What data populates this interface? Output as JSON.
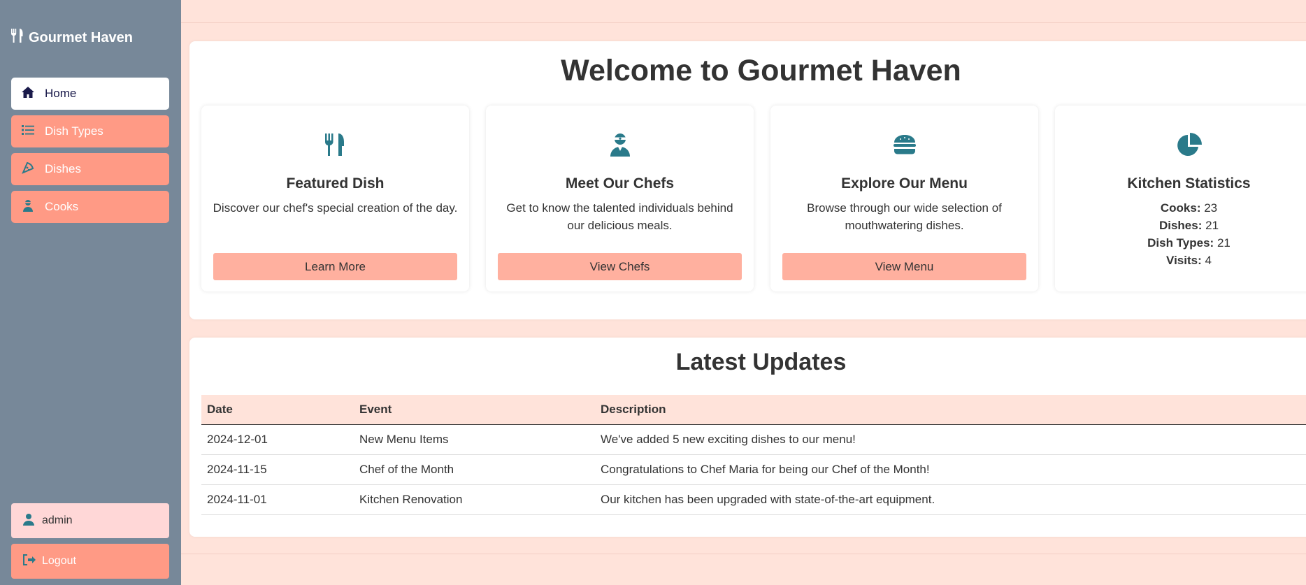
{
  "sidebar": {
    "brand": "Gourmet Haven",
    "items": [
      {
        "label": "Home",
        "icon": "home-icon"
      },
      {
        "label": "Dish Types",
        "icon": "list-icon"
      },
      {
        "label": "Dishes",
        "icon": "pizza-icon"
      },
      {
        "label": "Cooks",
        "icon": "chef-icon"
      }
    ],
    "user": "admin",
    "logout": "Logout"
  },
  "colors": {
    "sidebar_bg": "#778899",
    "accent": "#ff9a85",
    "button": "#ffb09f",
    "page_bg": "#ffe3da",
    "icon": "#2a7a8a"
  },
  "welcome": {
    "title": "Welcome to Gourmet Haven",
    "cards": [
      {
        "title": "Featured Dish",
        "text": "Discover our chef's special creation of the day.",
        "button": "Learn More",
        "icon": "utensils-icon"
      },
      {
        "title": "Meet Our Chefs",
        "text": "Get to know the talented individuals behind our delicious meals.",
        "button": "View Chefs",
        "icon": "chef-icon"
      },
      {
        "title": "Explore Our Menu",
        "text": "Browse through our wide selection of mouthwatering dishes.",
        "button": "View Menu",
        "icon": "burger-icon"
      },
      {
        "title": "Kitchen Statistics",
        "icon": "pie-chart-icon",
        "stats": [
          {
            "label": "Cooks:",
            "value": "23"
          },
          {
            "label": "Dishes:",
            "value": "21"
          },
          {
            "label": "Dish Types:",
            "value": "21"
          },
          {
            "label": "Visits:",
            "value": "4"
          }
        ]
      }
    ]
  },
  "updates": {
    "title": "Latest Updates",
    "columns": [
      "Date",
      "Event",
      "Description"
    ],
    "rows": [
      [
        "2024-12-01",
        "New Menu Items",
        "We've added 5 new exciting dishes to our menu!"
      ],
      [
        "2024-11-15",
        "Chef of the Month",
        "Congratulations to Chef Maria for being our Chef of the Month!"
      ],
      [
        "2024-11-01",
        "Kitchen Renovation",
        "Our kitchen has been upgraded with state-of-the-art equipment."
      ]
    ]
  }
}
